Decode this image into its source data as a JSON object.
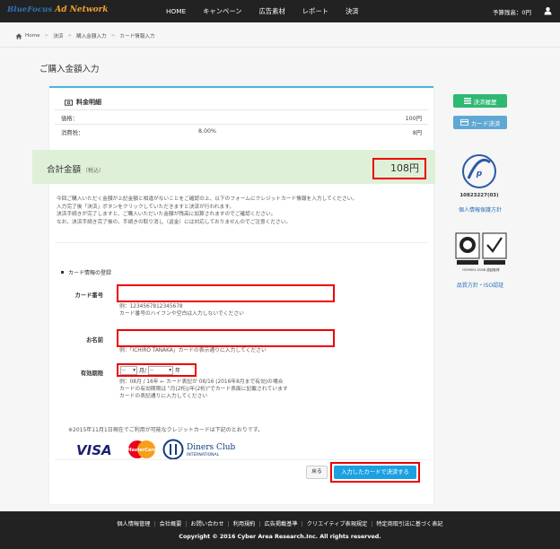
{
  "header": {
    "logo_part1": "BlueFocus",
    "logo_part2": "Ad Network",
    "nav": [
      "HOME",
      "キャンペーン",
      "広告素材",
      "レポート",
      "決済"
    ],
    "budget": "予算残高：0円"
  },
  "breadcrumb": [
    "Home",
    "決済",
    "購入金額入力",
    "カード情報入力"
  ],
  "page_title": "ご購入金額入力",
  "fee": {
    "heading": "料金明細",
    "price_label": "価格：",
    "price_value": "100円",
    "tax_label": "消費税：",
    "tax_rate": "8.00%",
    "tax_value": "8円"
  },
  "total": {
    "label": "合計金額",
    "suffix": "（税込）",
    "value": "108円"
  },
  "notice": [
    "今回ご購入いただく金額が上記金額と相違がないことをご確認の上、以下のフォームにクレジットカード情報を入力してください。",
    "入力完了後「決済」ボタンをクリックしていただきますと決済が行われます。",
    "決済手続きが完了しますと、ご購入いただいた金額が残高に加算されますのでご確認ください。",
    "なお、決済手続き完了後の、手続きの取り消し（返金）には対応しておりませんのでご注意ください。"
  ],
  "form": {
    "section_title": "カード情報の登録",
    "card_number_label": "カード番号",
    "card_number_value": "",
    "card_number_example": "例：1234567812345678",
    "card_number_help": "カード番号のハイフンや空白は入力しないでください",
    "name_label": "お名前",
    "name_value": "",
    "name_example": "例：「ICHIRO TANAKA」カードの表示通りに入力してください",
    "expiry_label": "有効期限",
    "month_value": "--",
    "month_unit": "月/",
    "year_value": "--",
    "year_unit": "年",
    "expiry_help": [
      "例：08月 / 16年 ← カード表記が 08/16 (2016年8月まで有効)の場合",
      "カードの有効期限は \"月(2桁)/年(2桁)\"でカード表面に記載されています",
      "カードの表記通りに入力してください"
    ]
  },
  "cards_note": "※2015年11月1日現在でご利用が可能なクレジットカードは下記のとおりです。",
  "card_brands": {
    "visa": "VISA",
    "master": "MasterCard",
    "diners_1": "Diners Club",
    "diners_2": "INTERNATIONAL"
  },
  "buttons": {
    "back": "戻る",
    "submit": "入力したカードで決済する"
  },
  "sidebar": {
    "history_button": "決済履歴",
    "card_button": "カード決済",
    "privacy_mark_number": "10823227(03)",
    "privacy_link": "個人情報保護方針",
    "quality_link": "品質方針・ISO認証",
    "iso_caption": "ISO9001:2008 認証取得"
  },
  "footer": {
    "links": [
      "個人情報管理",
      "会社概要",
      "お問い合わせ",
      "利用規約",
      "広告掲載基準",
      "クリエイティブ表現規定",
      "特定商取引法に基づく表記"
    ],
    "copyright": "Copyright © 2016 Cyber Area Research.Inc. All rights reserved."
  },
  "colors": {
    "topbar": "#222222",
    "accent": "#1ba1e2",
    "highlight": "#e00000",
    "total_bg": "#dff0d8",
    "history_btn": "#2eb872",
    "card_btn": "#5fa8d3"
  }
}
